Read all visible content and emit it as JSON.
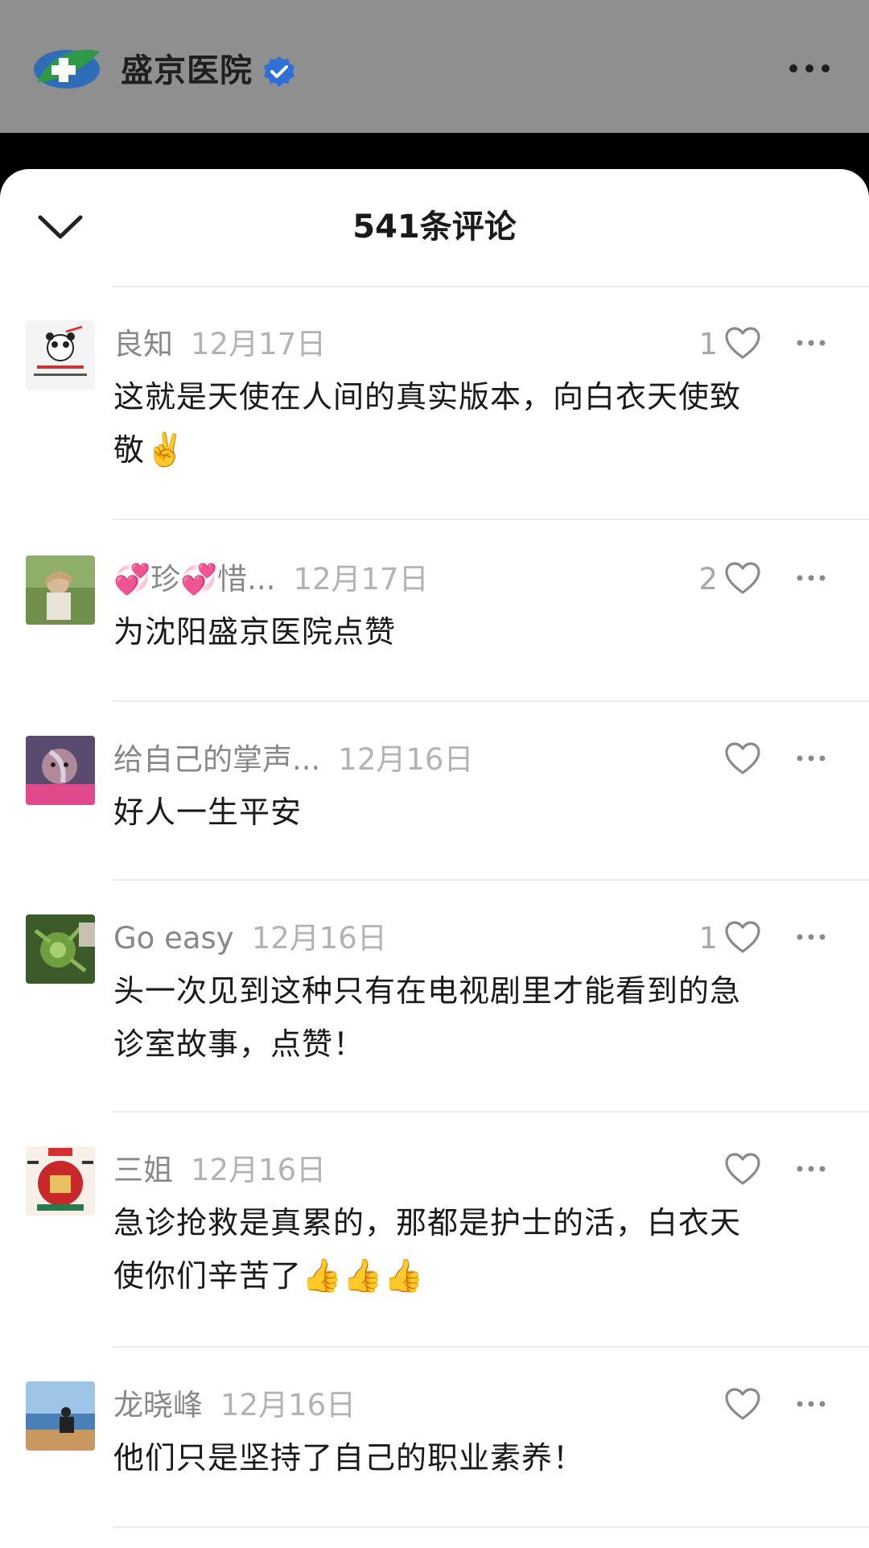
{
  "account": {
    "name": "盛京医院",
    "verified": true
  },
  "sheet": {
    "title": "541条评论"
  },
  "comments": [
    {
      "user": "良知",
      "date": "12月17日",
      "likes": "1",
      "text": "这就是天使在人间的真实版本，向白衣天使致敬",
      "emoji": "✌️"
    },
    {
      "user": "💞珍💞惜...",
      "date": "12月17日",
      "likes": "2",
      "text": "为沈阳盛京医院点赞",
      "emoji": ""
    },
    {
      "user": "给自己的掌声...",
      "date": "12月16日",
      "likes": "",
      "text": "好人一生平安",
      "emoji": ""
    },
    {
      "user": "Go easy",
      "date": "12月16日",
      "likes": "1",
      "text": "头一次见到这种只有在电视剧里才能看到的急诊室故事，点赞！",
      "emoji": ""
    },
    {
      "user": "三姐",
      "date": "12月16日",
      "likes": "",
      "text": "急诊抢救是真累的，那都是护士的活，白衣天使你们辛苦了",
      "emoji": "👍👍👍"
    },
    {
      "user": "龙晓峰",
      "date": "12月16日",
      "likes": "",
      "text": "他们只是坚持了自己的职业素养！",
      "emoji": ""
    }
  ],
  "icons": {
    "collapse": "chevron-down-icon",
    "like": "heart-outline-icon",
    "more": "more-dots-icon",
    "verified": "verified-badge-icon"
  },
  "colors": {
    "topbar": "#8f8f8f",
    "verified": "#2f6fd8",
    "meta_gray": "#888888"
  }
}
